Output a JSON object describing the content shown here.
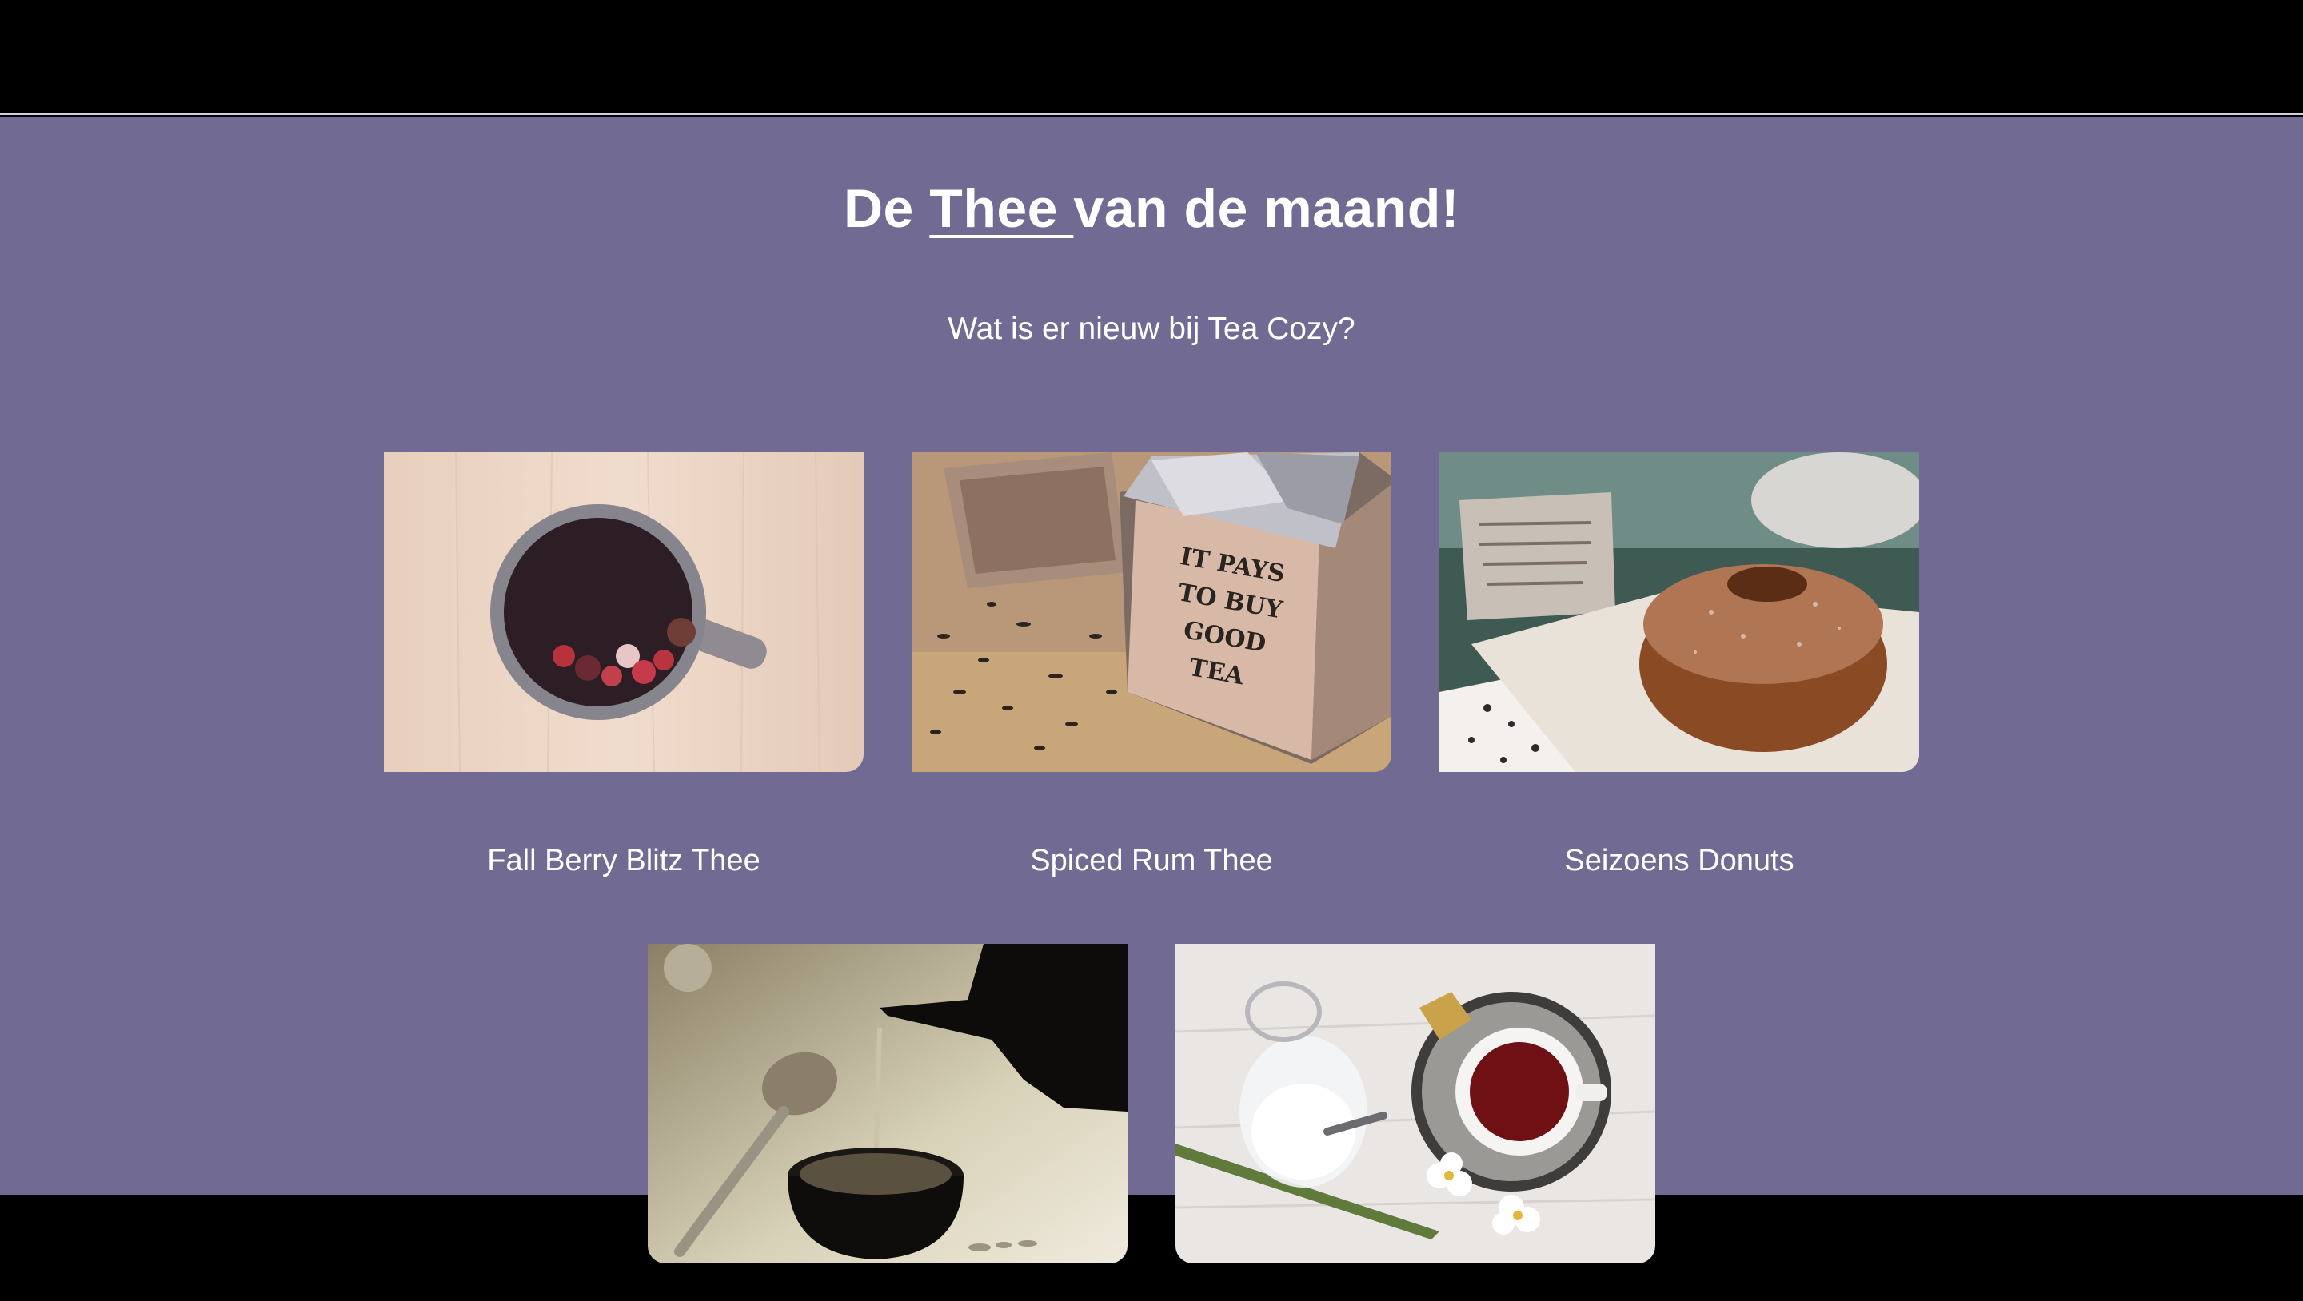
{
  "section": {
    "title_prefix": "De ",
    "title_highlight": "Thee ",
    "title_suffix": "van de maand!",
    "subtitle": "Wat is er nieuw bij Tea Cozy?"
  },
  "products": [
    {
      "name": "Fall Berry Blitz Thee",
      "image": "cup-of-berry-tea"
    },
    {
      "name": "Spiced Rum Thee",
      "image": "tea-box-it-pays-to-buy-good-tea",
      "box_text": [
        "IT PAYS",
        "TO BUY",
        "GOOD",
        "TEA"
      ]
    },
    {
      "name": "Seizoens Donuts",
      "image": "sugared-donut-on-plate"
    },
    {
      "name": "",
      "image": "teapot-pouring-tea"
    },
    {
      "name": "",
      "image": "tea-cup-with-sugar-jar"
    }
  ],
  "colors": {
    "background": "#716a93",
    "frame": "#000000",
    "text": "#ffffff"
  }
}
